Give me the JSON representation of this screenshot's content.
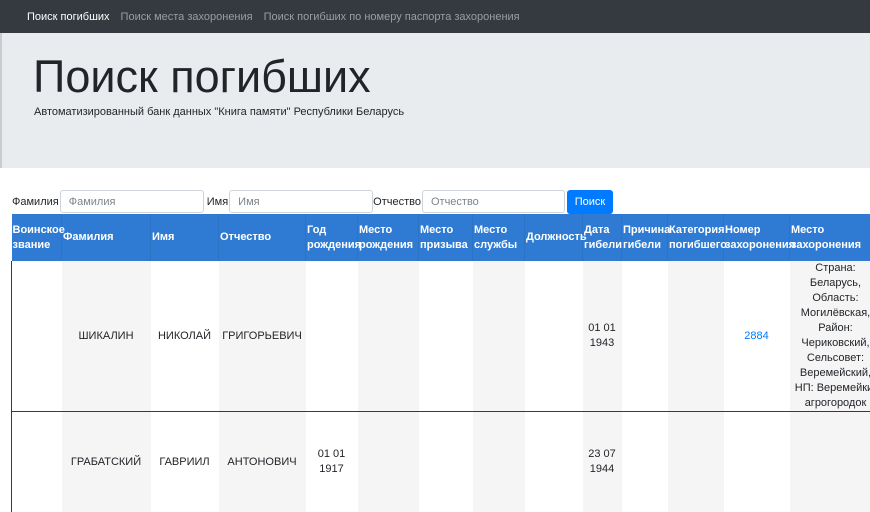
{
  "nav": {
    "items": [
      {
        "label": "Поиск погибших",
        "active": true
      },
      {
        "label": "Поиск места захоронения",
        "active": false
      },
      {
        "label": "Поиск погибших по номеру паспорта захоронения",
        "active": false
      }
    ]
  },
  "header": {
    "title": "Поиск погибших",
    "subtitle": "Автоматизированный банк данных \"Книга памяти\" Республики Беларусь"
  },
  "search": {
    "last_name_label": "Фамилия",
    "last_name_placeholder": "Фамилия",
    "first_name_label": "Имя",
    "first_name_placeholder": "Имя",
    "middle_name_label": "Отчество",
    "middle_name_placeholder": "Отчество",
    "submit_label": "Поиск"
  },
  "table": {
    "columns": {
      "rank": "Воинское звание",
      "last_name": "Фамилия",
      "first_name": "Имя",
      "middle_name": "Отчество",
      "birth_year": "Год рождения",
      "birth_place": "Место рождения",
      "draft_place": "Место призыва",
      "service_place": "Место службы",
      "position": "Должность",
      "death_date": "Дата гибели",
      "death_cause": "Причина гибели",
      "category": "Категория погибшего",
      "burial_number": "Номер захоронения",
      "burial_place": "Место захоронения"
    },
    "rows": [
      {
        "rank": "",
        "last_name": "ШИКАЛИН",
        "first_name": "НИКОЛАЙ",
        "middle_name": "ГРИГОРЬЕВИЧ",
        "birth_year": "",
        "birth_place": "",
        "draft_place": "",
        "service_place": "",
        "position": "",
        "death_date": "01 01 1943",
        "death_cause": "",
        "category": "",
        "burial_number": "2884",
        "burial_place": "Страна: Беларусь, Область: Могилёвская, Район: Чериковский, Сельсовет: Веремейский, НП: Веремейки, агрогородок"
      },
      {
        "rank": "",
        "last_name": "ГРАБАТСКИЙ",
        "first_name": "ГАВРИИЛ",
        "middle_name": "АНТОНОВИЧ",
        "birth_year": "01 01 1917",
        "birth_place": "",
        "draft_place": "",
        "service_place": "",
        "position": "",
        "death_date": "23 07 1944",
        "death_cause": "",
        "category": "",
        "burial_number": "",
        "burial_place": ""
      }
    ]
  }
}
